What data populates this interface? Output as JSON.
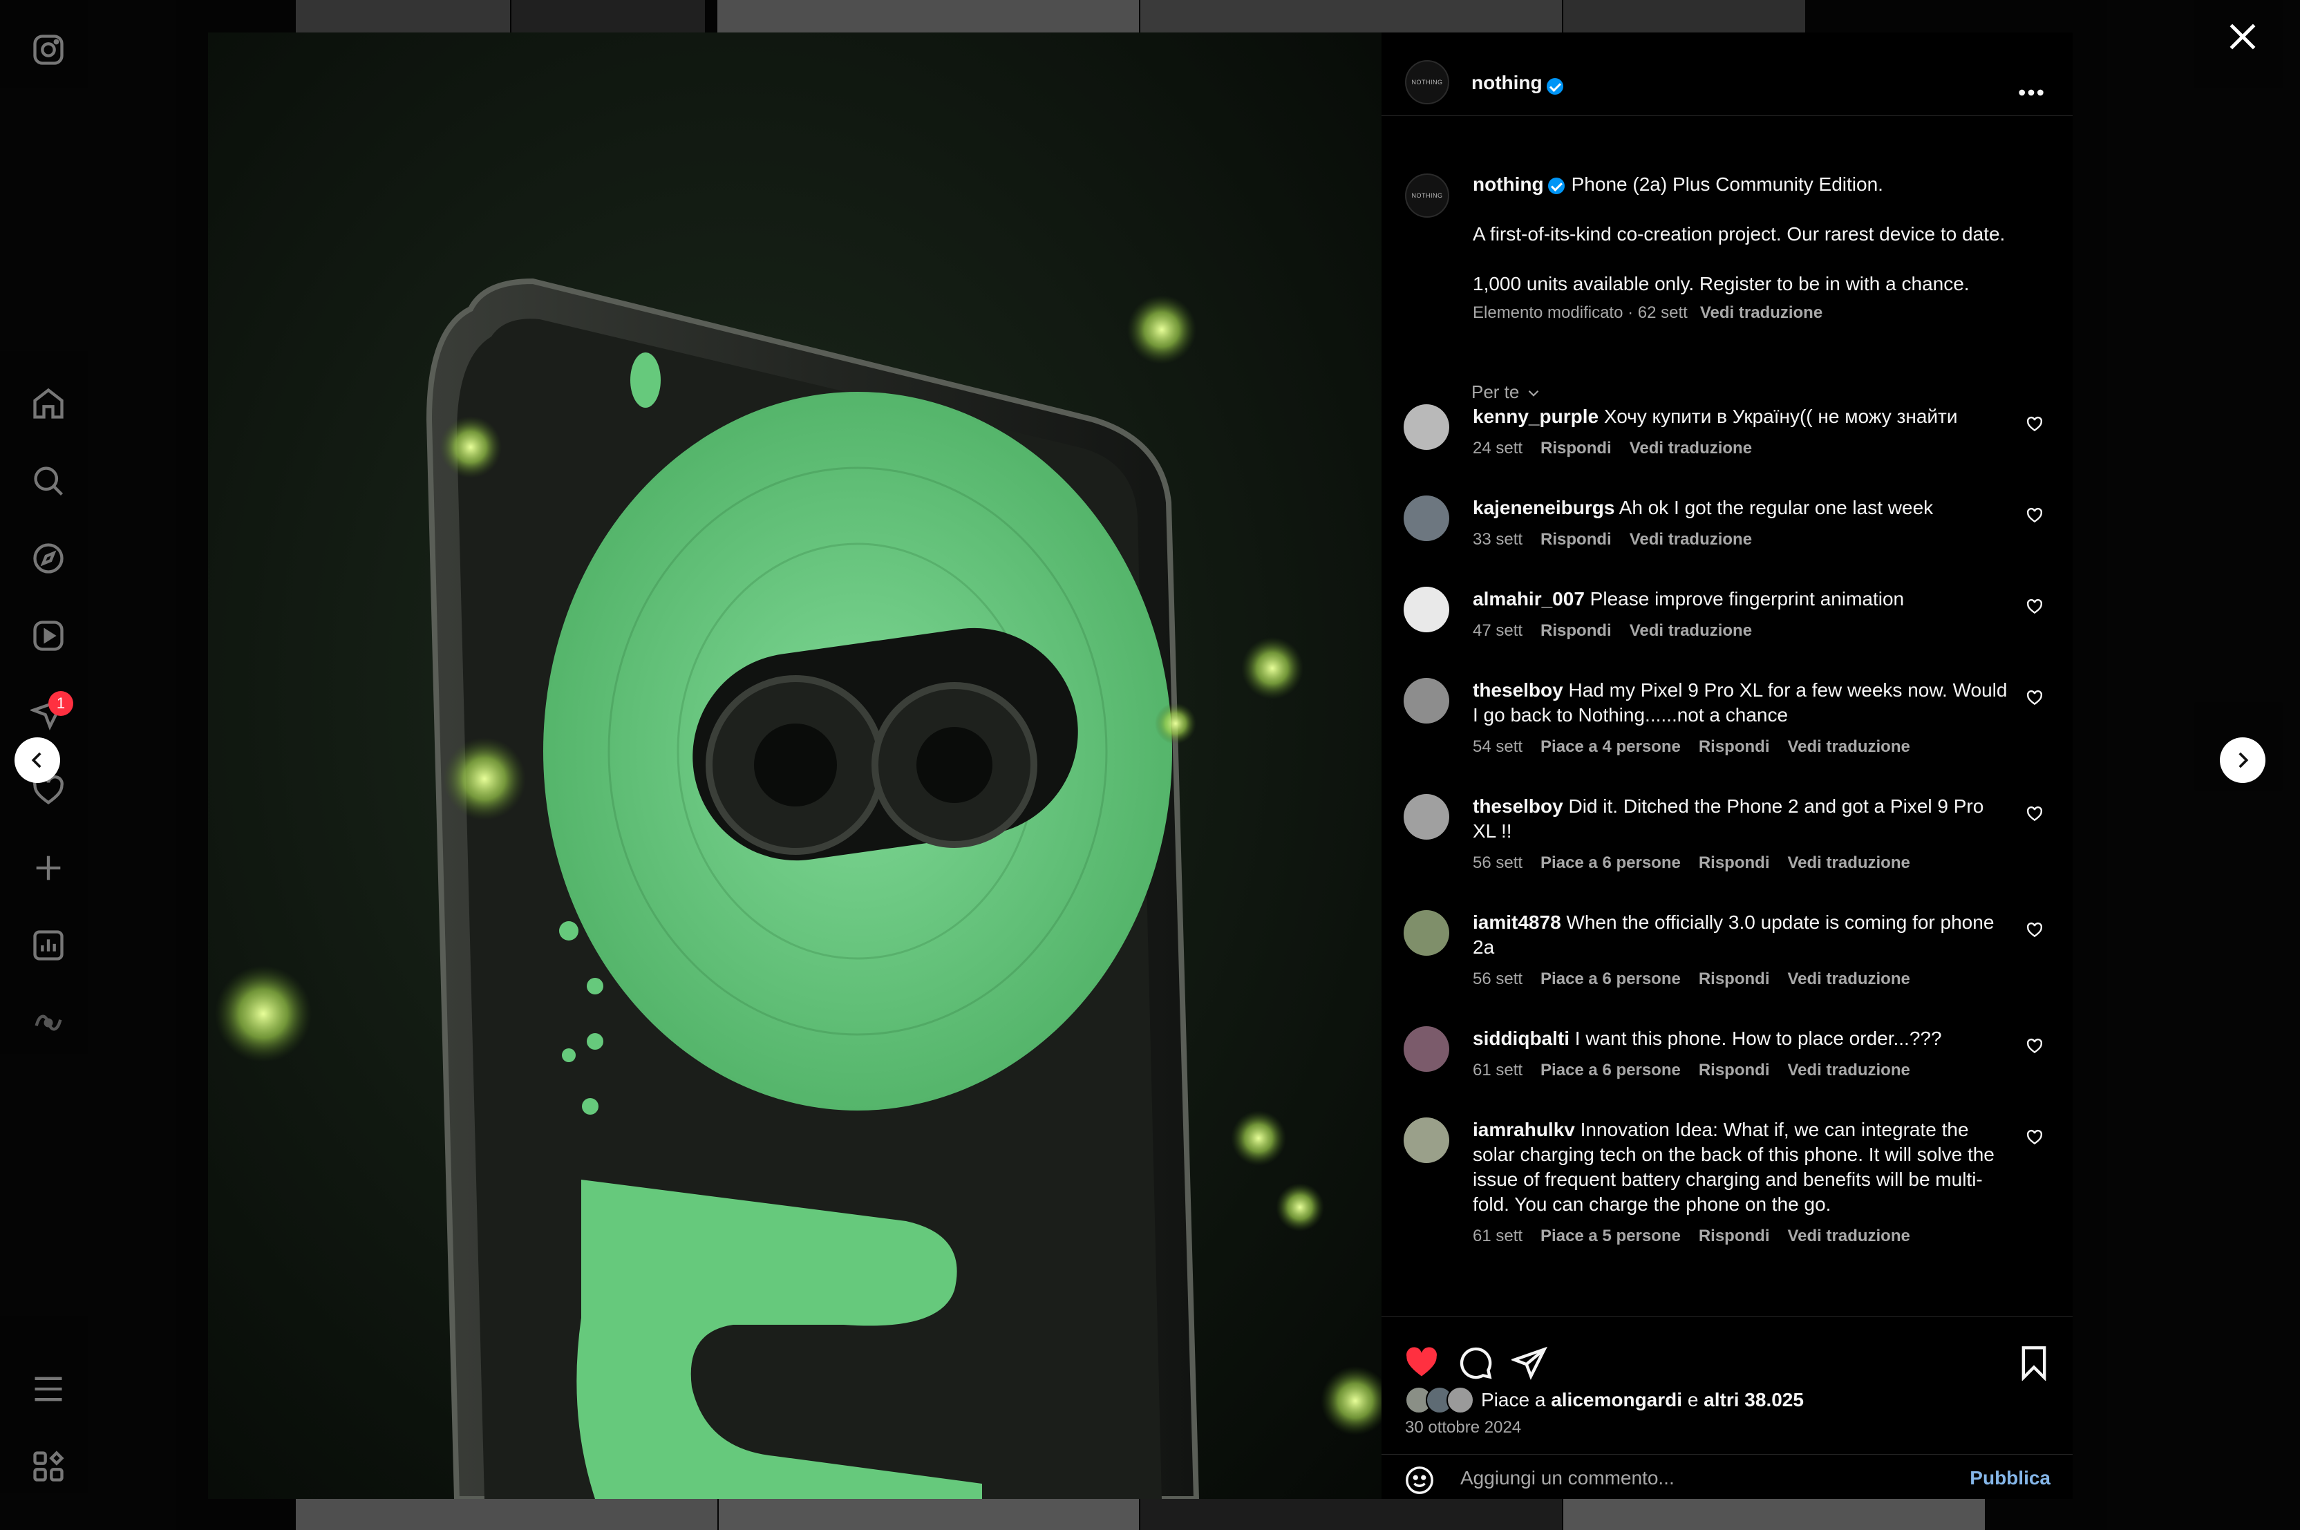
{
  "post": {
    "author": "nothing",
    "avatar_text": "NOTHING",
    "caption_lines": [
      "Phone (2a) Plus Community Edition.",
      "A first-of-its-kind co-creation project. Our rarest device to date.",
      "1,000 units available only. Register to be in with a chance."
    ],
    "caption_meta": "Elemento modificato · 62 sett",
    "caption_translate": "Vedi traduzione",
    "sort_label": "Per te",
    "likes_prefix": "Piace a ",
    "likes_user": "alicemongardi",
    "likes_mid": " e ",
    "likes_rest": "altri 38.025",
    "date": "30 ottobre 2024",
    "add_comment_placeholder": "Aggiungi un commento...",
    "publish_label": "Pubblica"
  },
  "nav": {
    "notification_count": "1",
    "icons": [
      "instagram-icon",
      "home-icon",
      "search-icon",
      "explore-icon",
      "reels-icon",
      "messages-icon",
      "notifications-icon",
      "create-icon",
      "dashboard-icon",
      "meta-ai-icon",
      "menu-icon",
      "threads-icon"
    ]
  },
  "comments": [
    {
      "user": "kenny_purple",
      "text": "Хочу купити в Україну(( не можу знайти",
      "time": "24 sett",
      "likes": "",
      "reply": "Rispondi",
      "translate": "Vedi traduzione"
    },
    {
      "user": "kajeneneiburgs",
      "text": "Ah ok I got the regular one last week",
      "time": "33 sett",
      "likes": "",
      "reply": "Rispondi",
      "translate": "Vedi traduzione"
    },
    {
      "user": "almahir_007",
      "text": "Please improve fingerprint animation",
      "time": "47 sett",
      "likes": "",
      "reply": "Rispondi",
      "translate": "Vedi traduzione"
    },
    {
      "user": "theselboy",
      "text": "Had my Pixel 9 Pro XL for a few weeks now. Would I go back to Nothing......not a chance",
      "time": "54 sett",
      "likes": "Piace a 4 persone",
      "reply": "Rispondi",
      "translate": "Vedi traduzione"
    },
    {
      "user": "theselboy",
      "text": "Did it. Ditched the Phone 2 and got a Pixel 9 Pro XL !!",
      "time": "56 sett",
      "likes": "Piace a 6 persone",
      "reply": "Rispondi",
      "translate": "Vedi traduzione"
    },
    {
      "user": "iamit4878",
      "text": "When the officially 3.0 update is coming for phone 2a",
      "time": "56 sett",
      "likes": "Piace a 6 persone",
      "reply": "Rispondi",
      "translate": "Vedi traduzione"
    },
    {
      "user": "siddiqbalti",
      "text": "I want this phone. How to place order...???",
      "time": "61 sett",
      "likes": "Piace a 6 persone",
      "reply": "Rispondi",
      "translate": "Vedi traduzione"
    },
    {
      "user": "iamrahulkv",
      "text": "Innovation Idea: What if, we can integrate the solar charging tech on the back of this phone. It will solve the issue of frequent battery charging and benefits will be multi-fold. You can charge the phone on the go.",
      "time": "61 sett",
      "likes": "Piace a 5 persone",
      "reply": "Rispondi",
      "translate": "Vedi traduzione"
    }
  ],
  "colors": {
    "accent_blue": "#0095f6",
    "like_red": "#ff3040",
    "glow_green": "#66c97c"
  }
}
